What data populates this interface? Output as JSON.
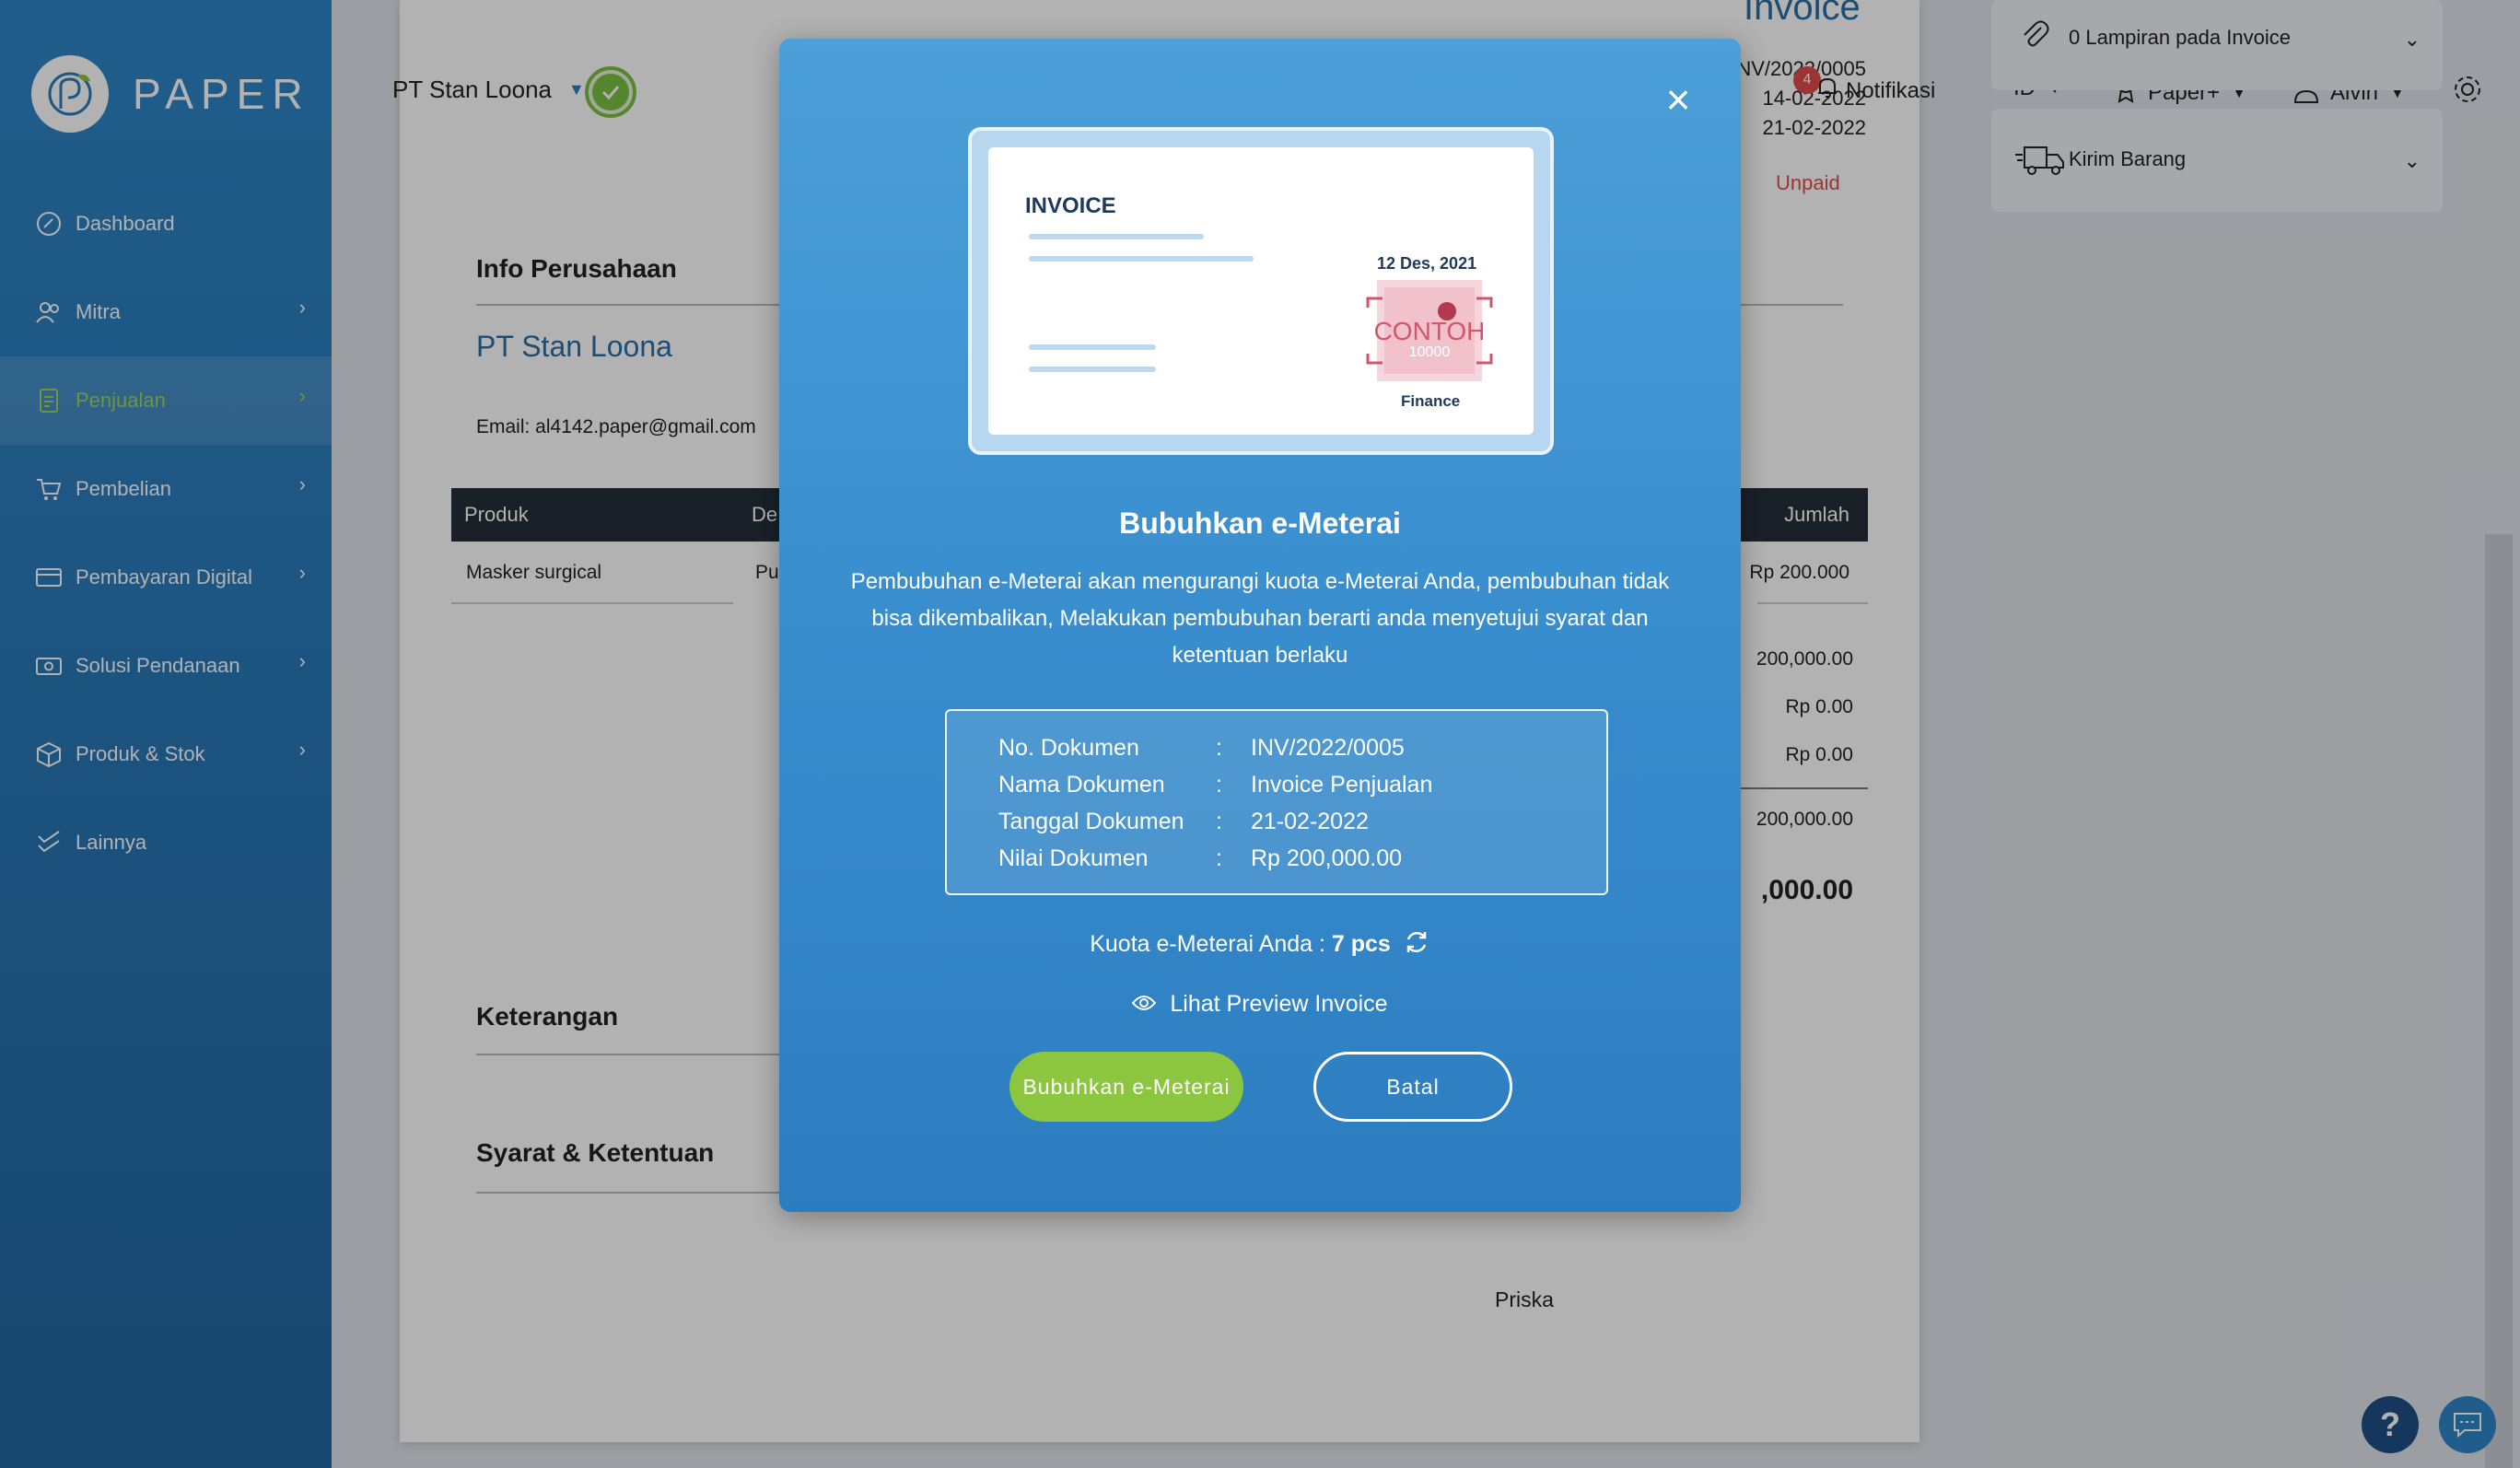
{
  "sidebar": {
    "logo_text": "PAPER",
    "items": [
      {
        "label": "Dashboard",
        "icon": "dashboard-icon",
        "has_children": false,
        "active": false
      },
      {
        "label": "Mitra",
        "icon": "users-icon",
        "has_children": true,
        "active": false
      },
      {
        "label": "Penjualan",
        "icon": "document-icon",
        "has_children": true,
        "active": true
      },
      {
        "label": "Pembelian",
        "icon": "cart-icon",
        "has_children": true,
        "active": false
      },
      {
        "label": "Pembayaran Digital",
        "icon": "card-icon",
        "has_children": true,
        "active": false
      },
      {
        "label": "Solusi Pendanaan",
        "icon": "money-icon",
        "has_children": true,
        "active": false
      },
      {
        "label": "Produk & Stok",
        "icon": "box-icon",
        "has_children": true,
        "active": false
      },
      {
        "label": "Lainnya",
        "icon": "check-list-icon",
        "has_children": false,
        "active": false
      }
    ]
  },
  "header": {
    "company": "PT Stan Loona",
    "notification_count": "4",
    "notification_label": "Notifikasi",
    "language": "ID",
    "plan": "Paper+",
    "user": "Alvin"
  },
  "right_panels": {
    "attachments": "0 Lampiran pada Invoice",
    "shipping": "Kirim Barang"
  },
  "invoice": {
    "title": "Invoice",
    "number_partial": "INV/2022/0005",
    "date": "14-02-2022",
    "due_date": "21-02-2022",
    "status": "Unpaid",
    "info_title": "Info Perusahaan",
    "company_name": "PT Stan Loona",
    "email": "Email: al4142.paper@gmail.com",
    "table_headers": {
      "product": "Produk",
      "desc": "De",
      "amount": "Jumlah"
    },
    "row": {
      "product": "Masker surgical",
      "desc": "Pu",
      "amount": "Rp 200.000"
    },
    "subtotals": [
      "200,000.00",
      "Rp 0.00",
      "Rp 0.00",
      "200,000.00"
    ],
    "grand_total": ",000.00",
    "keterangan_title": "Keterangan",
    "syarat_title": "Syarat & Ketentuan",
    "signer": "Priska"
  },
  "modal": {
    "preview": {
      "title": "INVOICE",
      "date": "12 Des, 2021",
      "stamp_text": "CONTOH",
      "stamp_value": "10000",
      "signer": "Finance"
    },
    "title": "Bubuhkan e-Meterai",
    "description": "Pembubuhan e-Meterai akan mengurangi kuota e-Meterai Anda, pembubuhan tidak bisa dikembalikan, Melakukan pembubuhan berarti anda menyetujui syarat dan ketentuan berlaku",
    "doc_rows": [
      {
        "key": "No. Dokumen",
        "value": "INV/2022/0005"
      },
      {
        "key": "Nama Dokumen",
        "value": "Invoice Penjualan"
      },
      {
        "key": "Tanggal Dokumen",
        "value": "21-02-2022"
      },
      {
        "key": "Nilai Dokumen",
        "value": "Rp 200,000.00"
      }
    ],
    "separator": ":",
    "quota_label": "Kuota e-Meterai Anda :",
    "quota_value": "7 pcs",
    "preview_link": "Lihat Preview Invoice",
    "primary_button": "Bubuhkan e-Meterai",
    "secondary_button": "Batal"
  },
  "colors": {
    "sidebar": "#2a7bbb",
    "accent_green": "#8cc63f",
    "modal_blue": "#3a8fcf",
    "status_unpaid": "#e04b4b"
  }
}
